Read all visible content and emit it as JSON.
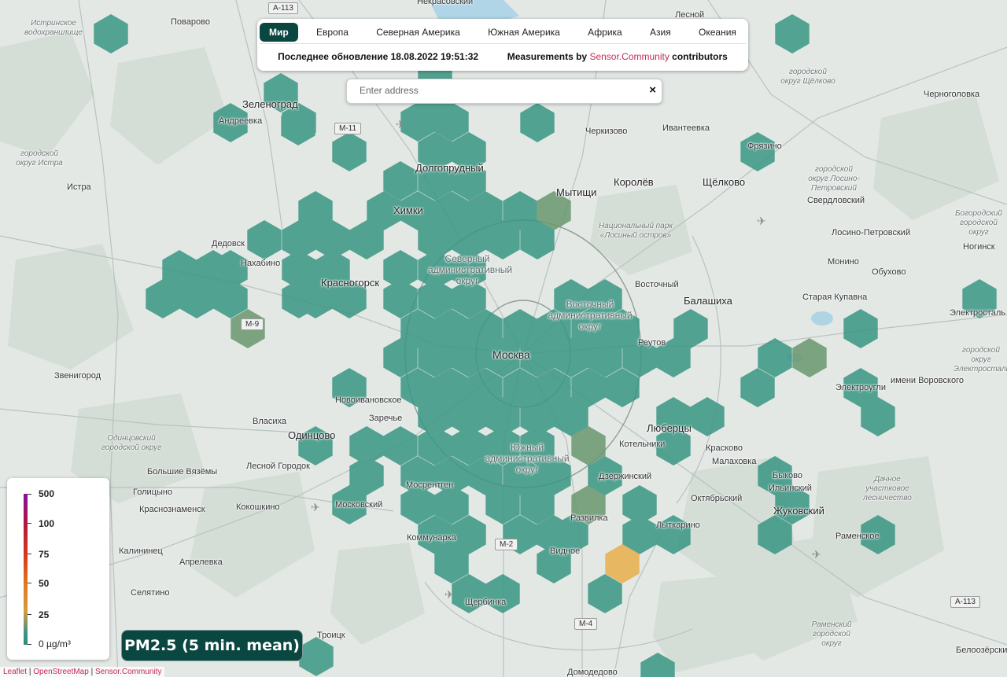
{
  "tabs": [
    "Мир",
    "Европа",
    "Северная Америка",
    "Южная Америка",
    "Африка",
    "Азия",
    "Океания"
  ],
  "active_tab": "Мир",
  "info": {
    "last_update": "Последнее обновление 18.08.2022 19:51:32",
    "measurements_prefix": "Measurements by",
    "measurements_link": "Sensor.Community",
    "measurements_suffix": "contributors"
  },
  "search": {
    "placeholder": "Enter address",
    "value": "",
    "clear_icon": "×"
  },
  "legend": {
    "labels": [
      "500",
      "100",
      "75",
      "50",
      "25",
      "0 µg/m³"
    ],
    "values": [
      500,
      100,
      75,
      50,
      25,
      0
    ]
  },
  "badge": {
    "label": "PM2.5 (5 min. mean)"
  },
  "attribution": {
    "leaflet": "Leaflet",
    "sep": "|",
    "osm": "OpenStreetMap",
    "sc": "Sensor.Community"
  },
  "colors": {
    "hex_low": "#3b9784",
    "hex_mid": "#6a9870",
    "hex_high": "#e8b04c",
    "active_tab": "#0b4741",
    "link": "#c52b55"
  },
  "map": {
    "places": [
      {
        "name": "Москва",
        "kind": "city"
      },
      {
        "name": "Химки",
        "kind": "big"
      },
      {
        "name": "Долгопрудный",
        "kind": "big"
      },
      {
        "name": "Мытищи",
        "kind": "big"
      },
      {
        "name": "Королёв",
        "kind": "big"
      },
      {
        "name": "Щёлково",
        "kind": "big"
      },
      {
        "name": "Балашиха",
        "kind": "big"
      },
      {
        "name": "Красногорск",
        "kind": "big"
      },
      {
        "name": "Зеленоград",
        "kind": "big"
      },
      {
        "name": "Одинцово",
        "kind": "big"
      },
      {
        "name": "Люберцы",
        "kind": "big"
      },
      {
        "name": "Жуковский",
        "kind": "big"
      },
      {
        "name": "Раменское",
        "kind": "normal"
      },
      {
        "name": "Электросталь",
        "kind": "normal"
      },
      {
        "name": "Ногинск",
        "kind": "normal"
      },
      {
        "name": "Домодедово",
        "kind": "normal"
      },
      {
        "name": "Троицк",
        "kind": "normal"
      },
      {
        "name": "Поварово",
        "kind": "normal"
      },
      {
        "name": "Андреевка",
        "kind": "normal"
      },
      {
        "name": "Истра",
        "kind": "normal"
      },
      {
        "name": "Дедовск",
        "kind": "normal"
      },
      {
        "name": "Нахабино",
        "kind": "normal"
      },
      {
        "name": "Звенигород",
        "kind": "normal"
      },
      {
        "name": "Власиха",
        "kind": "normal"
      },
      {
        "name": "Новоивановское",
        "kind": "normal"
      },
      {
        "name": "Заречье",
        "kind": "normal"
      },
      {
        "name": "Лесной Городок",
        "kind": "normal"
      },
      {
        "name": "Большие Вязёмы",
        "kind": "normal"
      },
      {
        "name": "Голицыно",
        "kind": "normal"
      },
      {
        "name": "Краснознаменск",
        "kind": "normal"
      },
      {
        "name": "Кокошкино",
        "kind": "normal"
      },
      {
        "name": "Калининец",
        "kind": "normal"
      },
      {
        "name": "Апрелевка",
        "kind": "normal"
      },
      {
        "name": "Селятино",
        "kind": "normal"
      },
      {
        "name": "Московский",
        "kind": "normal"
      },
      {
        "name": "Мосрентген",
        "kind": "normal"
      },
      {
        "name": "Коммунарка",
        "kind": "normal"
      },
      {
        "name": "Щербинка",
        "kind": "normal"
      },
      {
        "name": "Развилка",
        "kind": "normal"
      },
      {
        "name": "Видное",
        "kind": "normal"
      },
      {
        "name": "Дзержинский",
        "kind": "normal"
      },
      {
        "name": "Котельники",
        "kind": "normal"
      },
      {
        "name": "Лыткарино",
        "kind": "normal"
      },
      {
        "name": "Красково",
        "kind": "normal"
      },
      {
        "name": "Малаховка",
        "kind": "normal"
      },
      {
        "name": "Октябрьский",
        "kind": "normal"
      },
      {
        "name": "Быково",
        "kind": "normal"
      },
      {
        "name": "Ильинский",
        "kind": "normal"
      },
      {
        "name": "Реутов",
        "kind": "normal"
      },
      {
        "name": "Восточный",
        "kind": "normal"
      },
      {
        "name": "Старая Купавна",
        "kind": "normal"
      },
      {
        "name": "Электроугли",
        "kind": "normal"
      },
      {
        "name": "имени Воровского",
        "kind": "normal"
      },
      {
        "name": "Обухово",
        "kind": "normal"
      },
      {
        "name": "Монино",
        "kind": "normal"
      },
      {
        "name": "Лосино-Петровский",
        "kind": "normal"
      },
      {
        "name": "Свердловский",
        "kind": "normal"
      },
      {
        "name": "Фрязино",
        "kind": "normal"
      },
      {
        "name": "Ивантеевка",
        "kind": "normal"
      },
      {
        "name": "Черкизово",
        "kind": "normal"
      },
      {
        "name": "Черноголовка",
        "kind": "normal"
      },
      {
        "name": "Некрасовский",
        "kind": "normal"
      },
      {
        "name": "Лесной",
        "kind": "normal"
      },
      {
        "name": "Белоозёрский",
        "kind": "normal"
      },
      {
        "name": "Северный административный округ",
        "kind": "district"
      },
      {
        "name": "Восточный административный округ",
        "kind": "district"
      },
      {
        "name": "Южный административный округ",
        "kind": "district"
      },
      {
        "name": "Национальный парк «Лосиный остров»",
        "kind": "grey"
      },
      {
        "name": "Истринское водохранилище",
        "kind": "grey"
      },
      {
        "name": "городской округ Истра",
        "kind": "grey"
      },
      {
        "name": "Одинцовский городской округ",
        "kind": "grey"
      },
      {
        "name": "городской округ Щёлково",
        "kind": "grey"
      },
      {
        "name": "городской округ Лосино-Петровский",
        "kind": "grey"
      },
      {
        "name": "Богородский городской округ",
        "kind": "grey"
      },
      {
        "name": "городской округ Электросталь",
        "kind": "grey"
      },
      {
        "name": "Дачное участковое лесничество",
        "kind": "grey"
      },
      {
        "name": "Раменский городской округ",
        "kind": "grey"
      }
    ],
    "roads": [
      "A-113",
      "M-11",
      "M-9",
      "M-2",
      "M-4",
      "A-113"
    ]
  }
}
